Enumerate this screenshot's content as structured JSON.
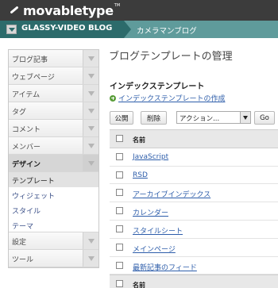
{
  "header": {
    "logo_text": "movabletype",
    "logo_tm": "TM"
  },
  "blogbar": {
    "blog_name": "GLASSY-VIDEO BLOG",
    "breadcrumb": "カメラマンブログ"
  },
  "sidebar": {
    "items_top": [
      {
        "label": "ブログ記事"
      },
      {
        "label": "ウェブページ"
      },
      {
        "label": "アイテム"
      },
      {
        "label": "タグ"
      },
      {
        "label": "コメント"
      },
      {
        "label": "メンバー"
      }
    ],
    "active_item": {
      "label": "デザイン"
    },
    "sub_items": [
      {
        "label": "テンプレート"
      },
      {
        "label": "ウィジェット"
      },
      {
        "label": "スタイル"
      },
      {
        "label": "テーマ"
      }
    ],
    "items_bottom": [
      {
        "label": "設定"
      },
      {
        "label": "ツール"
      }
    ]
  },
  "main": {
    "title": "ブログテンプレートの管理",
    "section_title": "インデックステンプレート",
    "create_link": "インデックステンプレートの作成",
    "toolbar": {
      "publish_label": "公開",
      "delete_label": "削除",
      "action_value": "アクション...",
      "go_label": "Go"
    },
    "table": {
      "header": "名前",
      "rows": [
        "JavaScript",
        "RSD",
        "アーカイブインデックス",
        "カレンダー",
        "スタイルシート",
        "メインページ",
        "最新記事のフィード"
      ],
      "footer": "名前"
    }
  }
}
